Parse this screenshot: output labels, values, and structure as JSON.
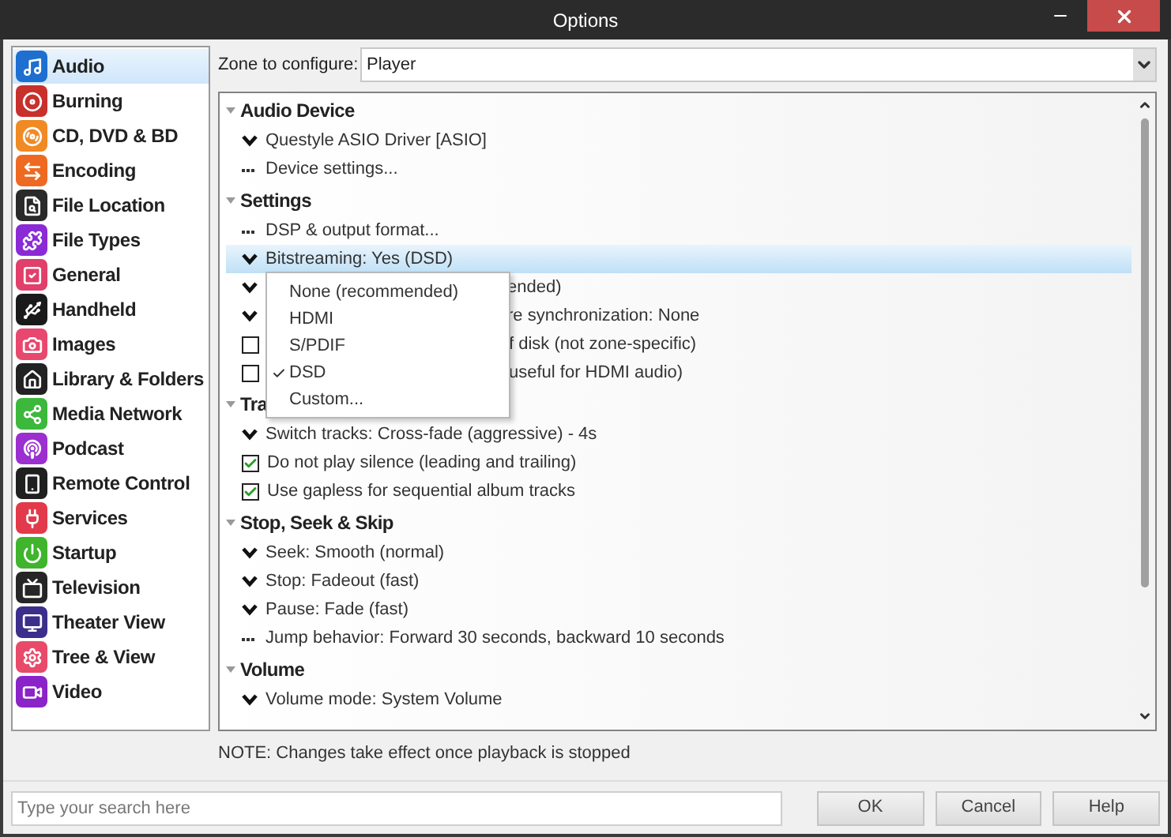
{
  "window": {
    "title": "Options"
  },
  "sidebar": {
    "items": [
      {
        "label": "Audio",
        "color": "#1e6fd0",
        "selected": true
      },
      {
        "label": "Burning",
        "color": "#c8302c",
        "selected": false
      },
      {
        "label": "CD, DVD & BD",
        "color": "#f08a24",
        "selected": false
      },
      {
        "label": "Encoding",
        "color": "#ee6a22",
        "selected": false
      },
      {
        "label": "File Location",
        "color": "#2a2a2a",
        "selected": false
      },
      {
        "label": "File Types",
        "color": "#8a2bd6",
        "selected": false
      },
      {
        "label": "General",
        "color": "#e0406a",
        "selected": false
      },
      {
        "label": "Handheld",
        "color": "#1a1a1a",
        "selected": false
      },
      {
        "label": "Images",
        "color": "#e8486e",
        "selected": false
      },
      {
        "label": "Library & Folders",
        "color": "#222222",
        "selected": false
      },
      {
        "label": "Media Network",
        "color": "#3cb83c",
        "selected": false
      },
      {
        "label": "Podcast",
        "color": "#9b2fd0",
        "selected": false
      },
      {
        "label": "Remote Control",
        "color": "#202020",
        "selected": false
      },
      {
        "label": "Services",
        "color": "#e23a4a",
        "selected": false
      },
      {
        "label": "Startup",
        "color": "#3fb42c",
        "selected": false
      },
      {
        "label": "Television",
        "color": "#262626",
        "selected": false
      },
      {
        "label": "Theater View",
        "color": "#3a2f8a",
        "selected": false
      },
      {
        "label": "Tree & View",
        "color": "#e84a6a",
        "selected": false
      },
      {
        "label": "Video",
        "color": "#8a24c8",
        "selected": false
      }
    ]
  },
  "zone": {
    "label": "Zone to configure:",
    "value": "Player"
  },
  "sections": [
    {
      "title": "Audio Device",
      "expanded": true,
      "rows": [
        {
          "kind": "dropdown",
          "text": "Questyle ASIO Driver [ASIO]",
          "selected": false
        },
        {
          "kind": "action",
          "text": "Device settings...",
          "selected": false
        }
      ]
    },
    {
      "title": "Settings",
      "expanded": true,
      "rows": [
        {
          "kind": "action",
          "text": "DSP & output format...",
          "selected": false
        },
        {
          "kind": "dropdown",
          "text": "Bitstreaming: Yes (DSD)",
          "selected": true
        },
        {
          "kind": "dropdown",
          "text": "ended)",
          "covered": true,
          "selected": false
        },
        {
          "kind": "dropdown",
          "text": "re synchronization: None",
          "covered": true,
          "selected": false
        },
        {
          "kind": "checkbox",
          "text": "f disk (not zone-specific)",
          "covered": true,
          "checked": false,
          "selected": false
        },
        {
          "kind": "checkbox",
          "text": "useful for HDMI audio)",
          "covered": true,
          "checked": false,
          "selected": false
        }
      ]
    },
    {
      "title": "Tra",
      "expanded": true,
      "rows": [
        {
          "kind": "dropdown",
          "text": "Switch tracks: Cross-fade (aggressive) - 4s",
          "selected": false
        },
        {
          "kind": "checkbox",
          "text": "Do not play silence (leading and trailing)",
          "checked": true,
          "selected": false
        },
        {
          "kind": "checkbox",
          "text": "Use gapless for sequential album tracks",
          "checked": true,
          "selected": false
        }
      ]
    },
    {
      "title": "Stop, Seek & Skip",
      "expanded": true,
      "rows": [
        {
          "kind": "dropdown",
          "text": "Seek: Smooth (normal)",
          "selected": false
        },
        {
          "kind": "dropdown",
          "text": "Stop: Fadeout (fast)",
          "selected": false
        },
        {
          "kind": "dropdown",
          "text": "Pause: Fade (fast)",
          "selected": false
        },
        {
          "kind": "action",
          "text": "Jump behavior: Forward 30 seconds, backward 10 seconds",
          "selected": false
        }
      ]
    },
    {
      "title": "Volume",
      "expanded": true,
      "rows": [
        {
          "kind": "dropdown",
          "text": "Volume mode: System Volume",
          "selected": false
        }
      ]
    }
  ],
  "menu": {
    "items": [
      {
        "label": "None (recommended)",
        "checked": false
      },
      {
        "label": "HDMI",
        "checked": false
      },
      {
        "label": "S/PDIF",
        "checked": false
      },
      {
        "label": "DSD",
        "checked": true
      },
      {
        "label": "Custom...",
        "checked": false
      }
    ]
  },
  "note": "NOTE: Changes take effect once playback is stopped",
  "search": {
    "placeholder": "Type your search here"
  },
  "buttons": [
    "OK",
    "Cancel",
    "Help"
  ]
}
